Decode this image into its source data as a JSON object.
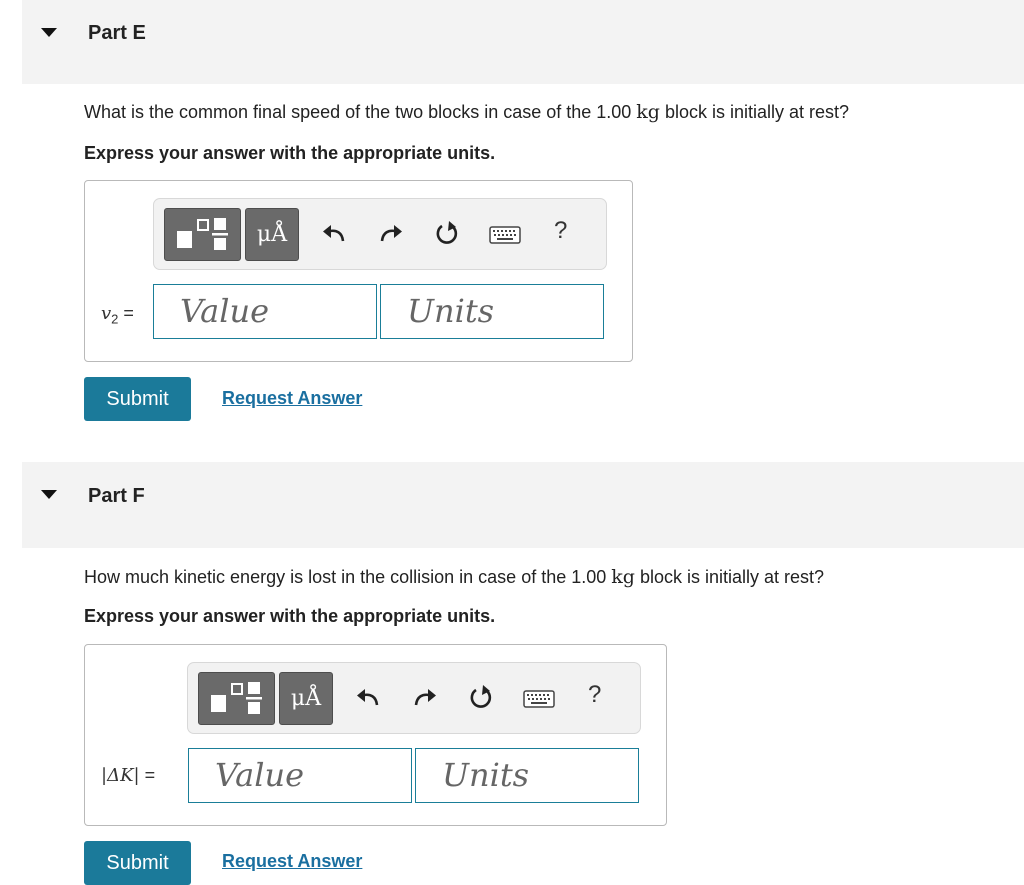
{
  "parts": [
    {
      "title": "Part E",
      "question_before": "What is the common final speed of the two blocks in case of the 1.00 ",
      "question_unit": "kg",
      "question_after": " block is initially at rest?",
      "instruction": "Express your answer with the appropriate units.",
      "variable_label": "v",
      "variable_sub": "2",
      "variable_eq": " =",
      "value_placeholder": "Value",
      "units_placeholder": "Units",
      "mu_label": "μÅ",
      "help_label": "?",
      "submit_label": "Submit",
      "request_label": "Request Answer"
    },
    {
      "title": "Part F",
      "question_before": "How much kinetic energy is lost in the collision in case of the 1.00 ",
      "question_unit": "kg",
      "question_after": " block is initially at rest?",
      "instruction": "Express your answer with the appropriate units.",
      "variable_label": "|ΔK|",
      "variable_eq": " =",
      "value_placeholder": "Value",
      "units_placeholder": "Units",
      "mu_label": "μÅ",
      "help_label": "?",
      "submit_label": "Submit",
      "request_label": "Request Answer"
    }
  ],
  "icons": {
    "caret": "caret-down-icon",
    "templates": "templates-icon",
    "undo": "undo-icon",
    "redo": "redo-icon",
    "reset": "reset-icon",
    "keyboard": "keyboard-icon"
  },
  "colors": {
    "header_bg": "#f3f3f3",
    "accent": "#1b7a9a",
    "link": "#1a6fa0",
    "toolbar_button": "#6a6a6a"
  }
}
